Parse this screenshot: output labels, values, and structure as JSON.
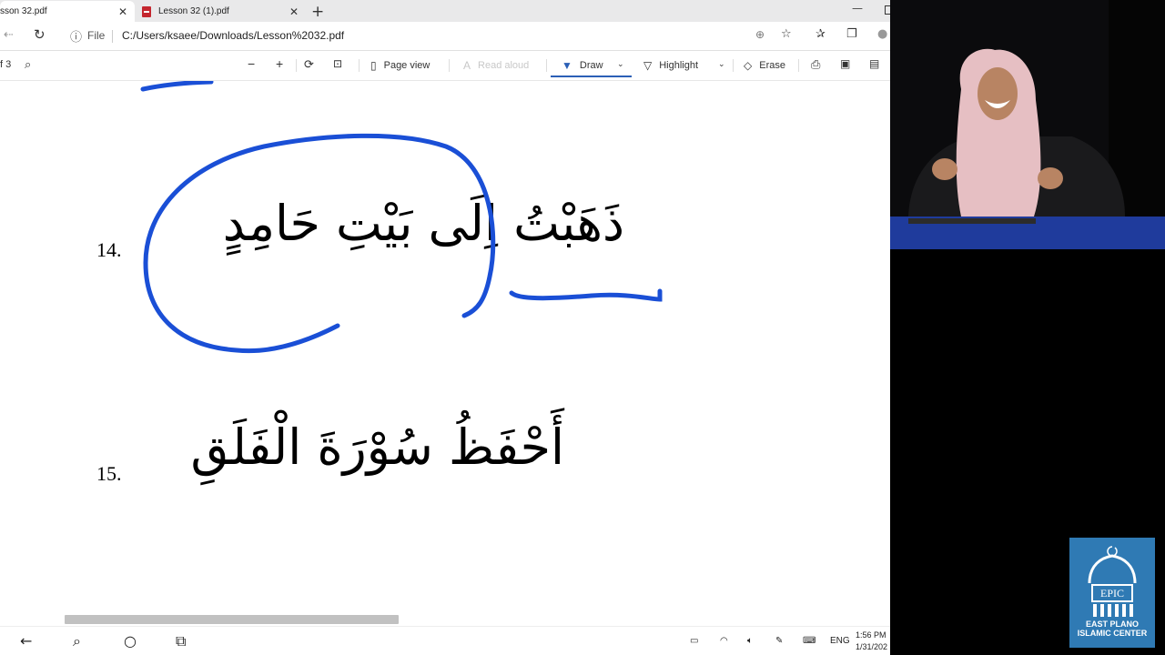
{
  "browser": {
    "tabs": [
      {
        "title": "sson 32.pdf",
        "active": true
      },
      {
        "title": "Lesson 32 (1).pdf",
        "active": false
      }
    ],
    "address": {
      "scheme_label": "File",
      "url": "C:/Users/ksaee/Downloads/Lesson%2032.pdf"
    }
  },
  "pdf_toolbar": {
    "page_of": "f 3",
    "page_view_label": "Page view",
    "read_aloud_label": "Read aloud",
    "draw_label": "Draw",
    "highlight_label": "Highlight",
    "erase_label": "Erase",
    "active_tool": "Draw",
    "accent_color": "#2b5fb6"
  },
  "document": {
    "items": [
      {
        "number": "14.",
        "arabic": "ذَهَبْتُ اِلَى بَيْتِ حَامِدٍ"
      },
      {
        "number": "15.",
        "arabic": "أَحْفَظُ سُوْرَةَ الْفَلَقِ"
      }
    ],
    "ink_color": "#1a4fd6"
  },
  "taskbar": {
    "language": "ENG",
    "time": "1:56 PM",
    "date": "1/31/202"
  },
  "logo": {
    "name": "EPIC",
    "line1": "EAST PLANO",
    "line2": "ISLAMIC CENTER",
    "color": "#2f7ab4"
  }
}
